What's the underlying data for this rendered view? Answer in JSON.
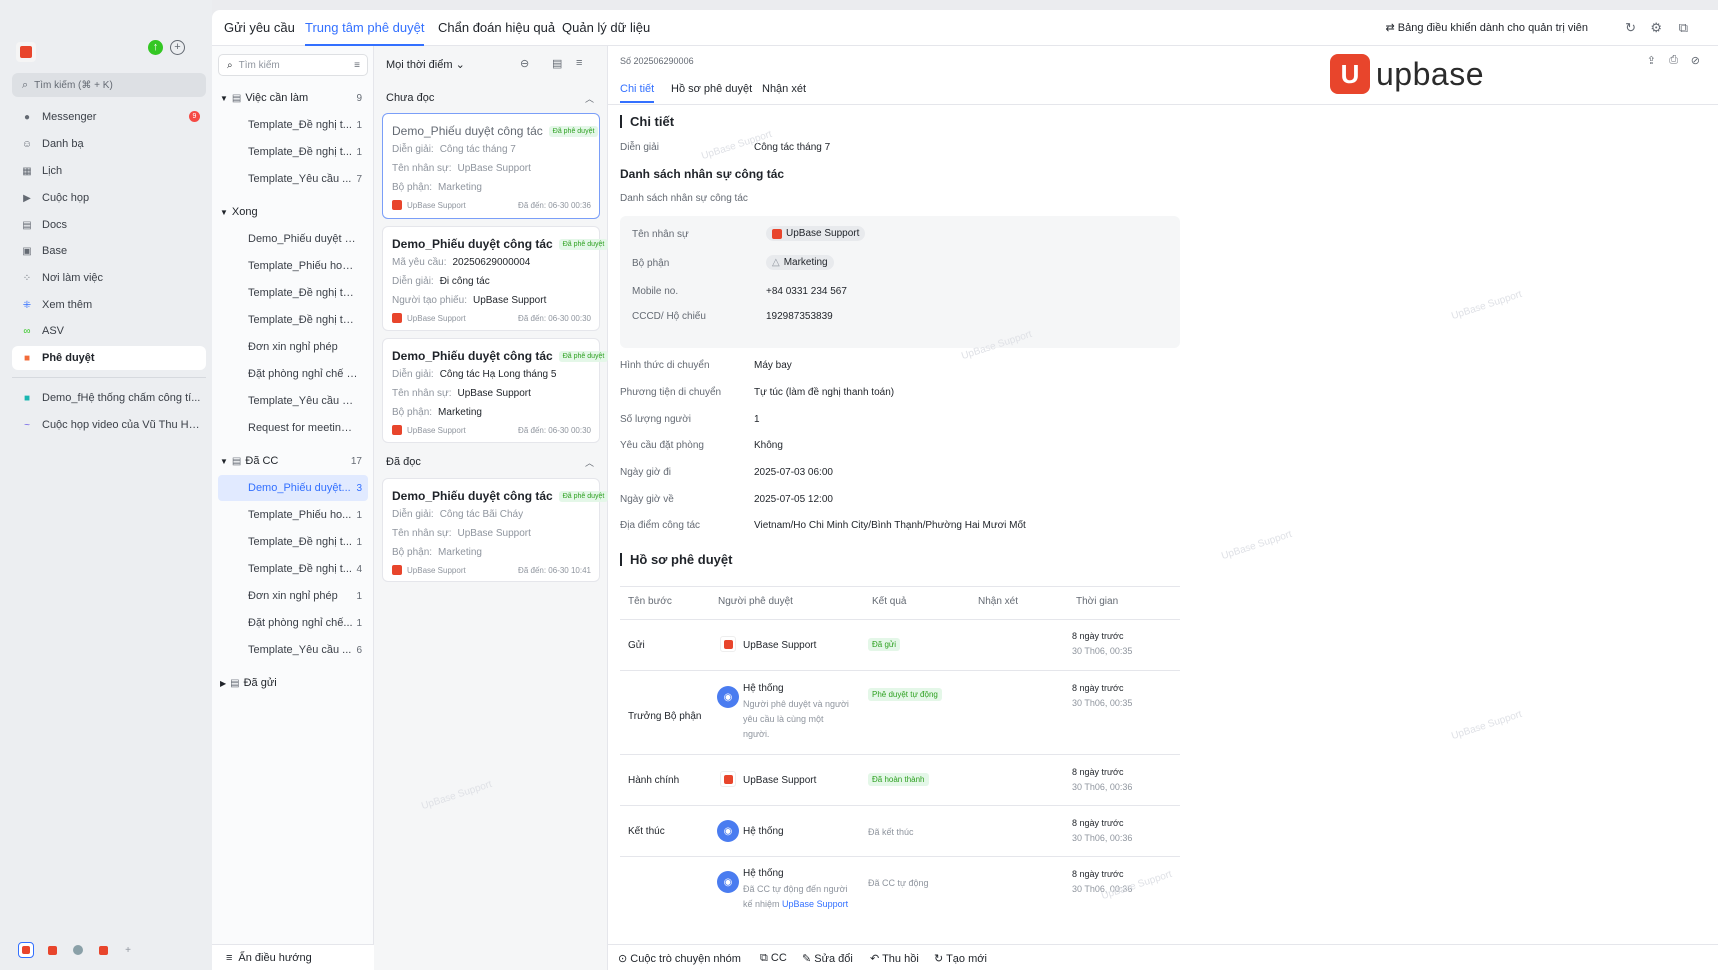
{
  "sidebar": {
    "search": "Tìm kiếm (⌘ + K)",
    "items": [
      {
        "label": "Messenger",
        "badge": "9"
      },
      {
        "label": "Danh bạ"
      },
      {
        "label": "Lịch"
      },
      {
        "label": "Cuộc họp"
      },
      {
        "label": "Docs"
      },
      {
        "label": "Base"
      },
      {
        "label": "Nơi làm việc"
      },
      {
        "label": "Xem thêm"
      },
      {
        "label": "ASV"
      },
      {
        "label": "Phê duyệt"
      }
    ],
    "pinned": [
      "Demo_fHệ thống chấm công tí...",
      "Cuộc họp video của Vũ Thu Hu..."
    ]
  },
  "topnav": {
    "tabs": [
      "Gửi yêu cầu",
      "Trung tâm phê duyệt",
      "Chẩn đoán hiệu quả",
      "Quản lý dữ liệu"
    ],
    "admin": "Bảng điều khiển dành cho quản trị viên"
  },
  "tree": {
    "search_placeholder": "Tìm kiếm",
    "groups": {
      "todo": {
        "label": "Việc cần làm",
        "count": "9"
      },
      "done": {
        "label": "Xong"
      },
      "cc": {
        "label": "Đã CC",
        "count": "17"
      },
      "sent": {
        "label": "Đã gửi"
      }
    },
    "todo_items": [
      {
        "label": "Template_Đề nghị t...",
        "count": "1"
      },
      {
        "label": "Template_Đề nghị t...",
        "count": "1"
      },
      {
        "label": "Template_Yêu cầu ...",
        "count": "7"
      }
    ],
    "done_items": [
      "Demo_Phiếu duyệt cô...",
      "Template_Phiếu hoàn...",
      "Template_Đề nghị tạ...",
      "Template_Đề nghị tha...",
      "Đơn xin nghỉ phép",
      "Đặt phòng nghỉ chế đ...",
      "Template_Yêu cầu đặt...",
      "Request for meeting r..."
    ],
    "cc_items": [
      {
        "label": "Demo_Phiếu duyệt...",
        "count": "3"
      },
      {
        "label": "Template_Phiếu ho...",
        "count": "1"
      },
      {
        "label": "Template_Đề nghị t...",
        "count": "1"
      },
      {
        "label": "Template_Đề nghị t...",
        "count": "4"
      },
      {
        "label": "Đơn xin nghỉ phép",
        "count": "1"
      },
      {
        "label": "Đặt phòng nghỉ chế...",
        "count": "1"
      },
      {
        "label": "Template_Yêu cầu ...",
        "count": "6"
      }
    ],
    "footer": "Ẩn điều hướng"
  },
  "list": {
    "filter": "Mọi thời điểm",
    "unread_label": "Chưa đọc",
    "read_label": "Đã đọc",
    "cards": [
      {
        "title": "Demo_Phiếu duyệt công tác",
        "tag": "Đã phê duyệt",
        "l1k": "Diễn giải",
        "l1v": "Công tác tháng 7",
        "l2k": "Tên nhân sự",
        "l2v": "UpBase Support",
        "l3k": "Bộ phận",
        "l3v": "Marketing",
        "user": "UpBase Support",
        "date": "Đã đến: 06-30 00:36"
      },
      {
        "title": "Demo_Phiếu duyệt công tác",
        "tag": "Đã phê duyệt",
        "l1k": "Mã yêu cầu",
        "l1v": "20250629000004",
        "l2k": "Diễn giải",
        "l2v": "Đi công tác",
        "l3k": "Người tạo phiếu",
        "l3v": "UpBase Support",
        "user": "UpBase Support",
        "date": "Đã đến: 06-30 00:30"
      },
      {
        "title": "Demo_Phiếu duyệt công tác",
        "tag": "Đã phê duyệt",
        "l1k": "Diễn giải",
        "l1v": "Công tác Hạ Long tháng 5",
        "l2k": "Tên nhân sự",
        "l2v": "UpBase Support",
        "l3k": "Bộ phận",
        "l3v": "Marketing",
        "user": "UpBase Support",
        "date": "Đã đến: 06-30 00:30"
      },
      {
        "title": "Demo_Phiếu duyệt công tác",
        "tag": "Đã phê duyệt",
        "l1k": "Diễn giải",
        "l1v": "Công tác Bãi Cháy",
        "l2k": "Tên nhân sự",
        "l2v": "UpBase Support",
        "l3k": "Bộ phận",
        "l3v": "Marketing",
        "user": "UpBase Support",
        "date": "Đã đến: 06-30 10:41"
      }
    ]
  },
  "detail": {
    "number": "Số 202506290006",
    "tabs": [
      "Chi tiết",
      "Hồ sơ phê duyệt",
      "Nhận xét"
    ],
    "section_detail": "Chi tiết",
    "dien_giai_label": "Diễn giải",
    "dien_giai": "Công tác tháng 7",
    "staff_title": "Danh sách nhân sự công tác",
    "staff_sub": "Danh sách nhân sự công tác",
    "staff": {
      "name_label": "Tên nhân sự",
      "name": "UpBase Support",
      "dept_label": "Bộ phận",
      "dept": "Marketing",
      "mobile_label": "Mobile no.",
      "mobile": "+84 0331 234 567",
      "id_label": "CCCD/ Hộ chiếu",
      "id": "192987353839"
    },
    "fields": [
      {
        "label": "Hình thức di chuyển",
        "value": "Máy bay"
      },
      {
        "label": "Phương tiện di chuyển",
        "value": "Tự túc (làm đề nghị thanh toán)"
      },
      {
        "label": "Số lượng người",
        "value": "1"
      },
      {
        "label": "Yêu cầu đặt phòng",
        "value": "Không"
      },
      {
        "label": "Ngày giờ đi",
        "value": "2025-07-03 06:00"
      },
      {
        "label": "Ngày giờ về",
        "value": "2025-07-05 12:00"
      },
      {
        "label": "Địa điểm công tác",
        "value": "Vietnam/Ho Chi Minh City/Bình Thạnh/Phường Hai Mươi Mốt"
      }
    ],
    "section_history": "Hồ sơ phê duyệt",
    "table_headers": [
      "Tên bước",
      "Người phê duyệt",
      "Kết quả",
      "Nhận xét",
      "Thời gian"
    ],
    "rows": [
      {
        "step": "Gửi",
        "approver": "UpBase Support",
        "result": "Đã gửi",
        "t1": "8 ngày trước",
        "t2": "30 Th06, 00:35"
      },
      {
        "step": "Trưởng Bộ phận",
        "approver": "Hệ thống",
        "note1": "Người phê duyệt và người",
        "note2": "yêu cầu là cùng một",
        "note3": "người.",
        "result": "Phê duyệt tự động",
        "t1": "8 ngày trước",
        "t2": "30 Th06, 00:35"
      },
      {
        "step": "Hành chính",
        "approver": "UpBase Support",
        "result": "Đã hoàn thành",
        "t1": "8 ngày trước",
        "t2": "30 Th06, 00:36"
      },
      {
        "step": "Kết thúc",
        "approver": "Hệ thống",
        "result": "Đã kết thúc",
        "t1": "8 ngày trước",
        "t2": "30 Th06, 00:36"
      },
      {
        "step": "",
        "approver": "Hệ thống",
        "note1": "Đã CC tự động đến người",
        "note2": "kế nhiệm",
        "note_link": "UpBase Support",
        "result": "Đã CC tự động",
        "t1": "8 ngày trước",
        "t2": "30 Th06, 00:36"
      }
    ],
    "footer_actions": [
      "Cuộc trò chuyện nhóm",
      "CC",
      "Sửa đổi",
      "Thu hồi",
      "Tạo mới"
    ]
  },
  "brand": {
    "name": "upbase",
    "mark": "U"
  },
  "watermark": "UpBase Support",
  "colors": {
    "accent": "#3370ff",
    "brand": "#e8452c",
    "success": "#2ea121"
  }
}
